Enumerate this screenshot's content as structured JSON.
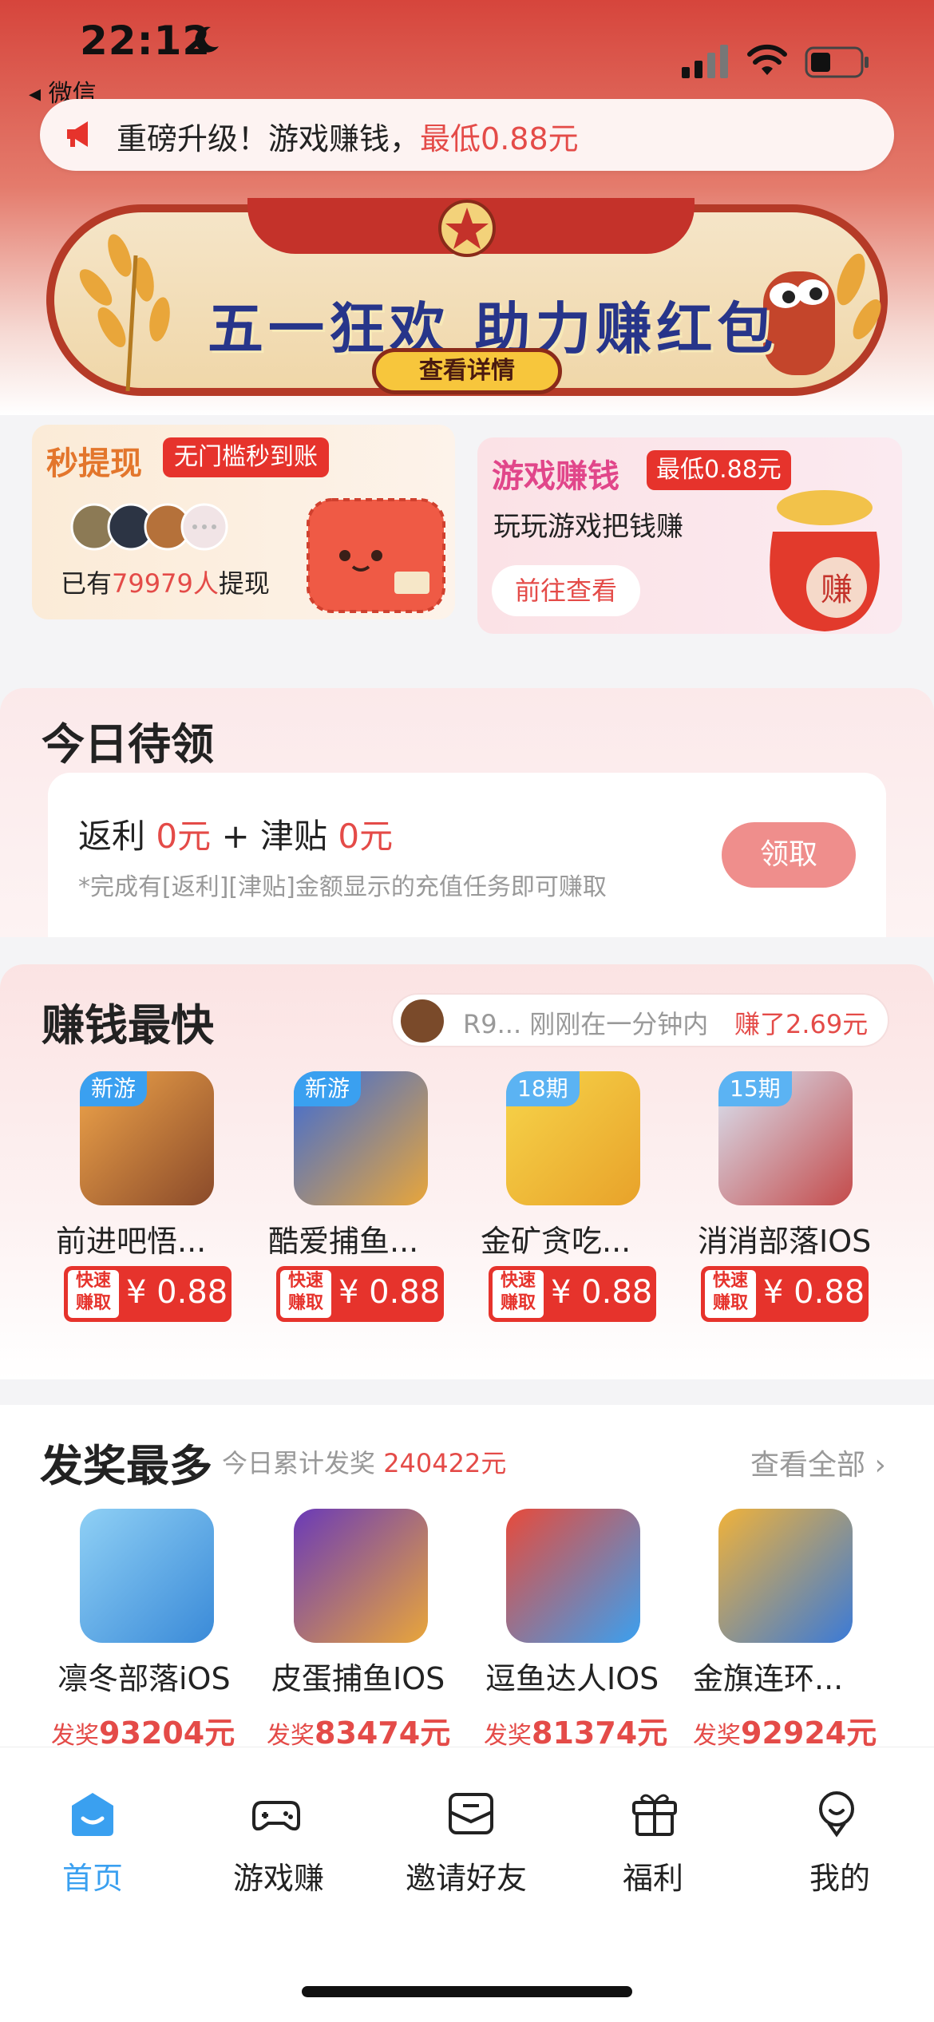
{
  "status": {
    "time": "22:12",
    "back_app": "◂ 微信"
  },
  "notice": {
    "text": "重磅升级！游戏赚钱，",
    "highlight": "最低0.88元"
  },
  "banner": {
    "title": "五一狂欢  助力赚红包",
    "button": "查看详情"
  },
  "quick_left": {
    "title": "秒提现",
    "tag": "无门槛秒到账",
    "count_prefix": "已有",
    "count_value": "79979人",
    "count_suffix": "提现"
  },
  "quick_right": {
    "title": "游戏赚钱",
    "tag": "最低0.88元",
    "subtitle": "玩玩游戏把钱赚",
    "button": "前往查看"
  },
  "today": {
    "title": "今日待领",
    "rebate_label": "返利 ",
    "rebate_value": "0元",
    "plus": " + ",
    "allowance_label": "津贴 ",
    "allowance_value": "0元",
    "note": "*完成有[返利][津贴]金额显示的充值任务即可赚取",
    "claim_button": "领取"
  },
  "fastest": {
    "title": "赚钱最快",
    "live_text": "R9... 刚刚在一分钟内",
    "live_amount": "赚了2.69元",
    "price_tag_line1": "快速",
    "price_tag_line2": "赚取",
    "games": [
      {
        "tag": "新游",
        "name": "前进吧悟...",
        "price": "¥ 0.88"
      },
      {
        "tag": "新游",
        "name": "酷爱捕鱼...",
        "price": "¥ 0.88"
      },
      {
        "tag": "18期",
        "name": "金矿贪吃...",
        "price": "¥ 0.88"
      },
      {
        "tag": "15期",
        "name": "消消部落IOS",
        "price": "¥ 0.88"
      }
    ]
  },
  "awards": {
    "title": "发奖最多",
    "sub_prefix": "今日累计发奖 ",
    "sub_value": "240422元",
    "see_all": "查看全部 ›",
    "amount_prefix": "发奖",
    "games": [
      {
        "name": "凛冬部落iOS",
        "amount": "93204元"
      },
      {
        "name": "皮蛋捕鱼IOS",
        "amount": "83474元"
      },
      {
        "name": "逗鱼达人IOS",
        "amount": "81374元"
      },
      {
        "name": "金旗连环...",
        "amount": "92924元"
      }
    ]
  },
  "tabs": [
    {
      "label": "首页",
      "icon": "home-icon",
      "active": true
    },
    {
      "label": "游戏赚",
      "icon": "gamepad-icon",
      "active": false
    },
    {
      "label": "邀请好友",
      "icon": "invite-icon",
      "active": false
    },
    {
      "label": "福利",
      "icon": "gift-icon",
      "active": false
    },
    {
      "label": "我的",
      "icon": "profile-icon",
      "active": false
    }
  ],
  "colors": {
    "accent": "#e44b48",
    "tab_active": "#3aa0f0",
    "primary_red": "#e6332c"
  }
}
